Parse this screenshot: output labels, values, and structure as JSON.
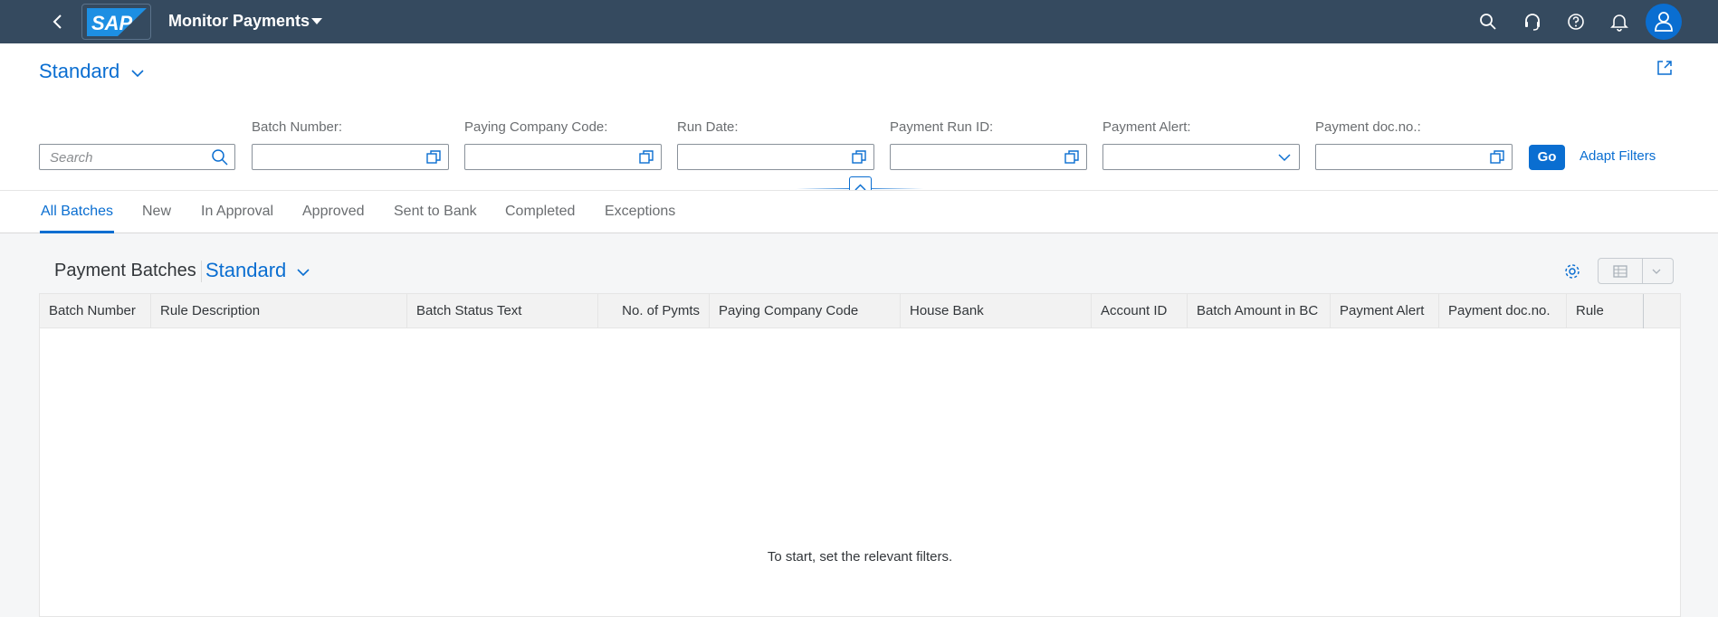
{
  "shell": {
    "logo_text": "SAP",
    "app_title": "Monitor Payments",
    "icons": [
      "back-icon",
      "search-icon",
      "headset-icon",
      "help-icon",
      "bell-icon",
      "user-icon"
    ]
  },
  "header": {
    "variant": "Standard",
    "filters": [
      {
        "label": "",
        "placeholder": "Search"
      },
      {
        "label": "Batch Number:"
      },
      {
        "label": "Paying Company Code:"
      },
      {
        "label": "Run Date:"
      },
      {
        "label": "Payment Run ID:"
      },
      {
        "label": "Payment Alert:"
      },
      {
        "label": "Payment doc.no.:"
      }
    ],
    "go_label": "Go",
    "adapt_label": "Adapt Filters"
  },
  "tabs": [
    "All Batches",
    "New",
    "In Approval",
    "Approved",
    "Sent to Bank",
    "Completed",
    "Exceptions"
  ],
  "active_tab": "All Batches",
  "table": {
    "title": "Payment Batches",
    "variant": "Standard",
    "columns": [
      "Batch Number",
      "Rule Description",
      "Batch Status Text",
      "No. of Pymts",
      "Paying Company Code",
      "House Bank",
      "Account ID",
      "Batch Amount in BC",
      "Payment Alert",
      "Payment doc.no.",
      "Rule"
    ],
    "empty_text": "To start, set the relevant filters."
  },
  "colors": {
    "shell": "#354a5f",
    "accent": "#0a6ed1"
  }
}
